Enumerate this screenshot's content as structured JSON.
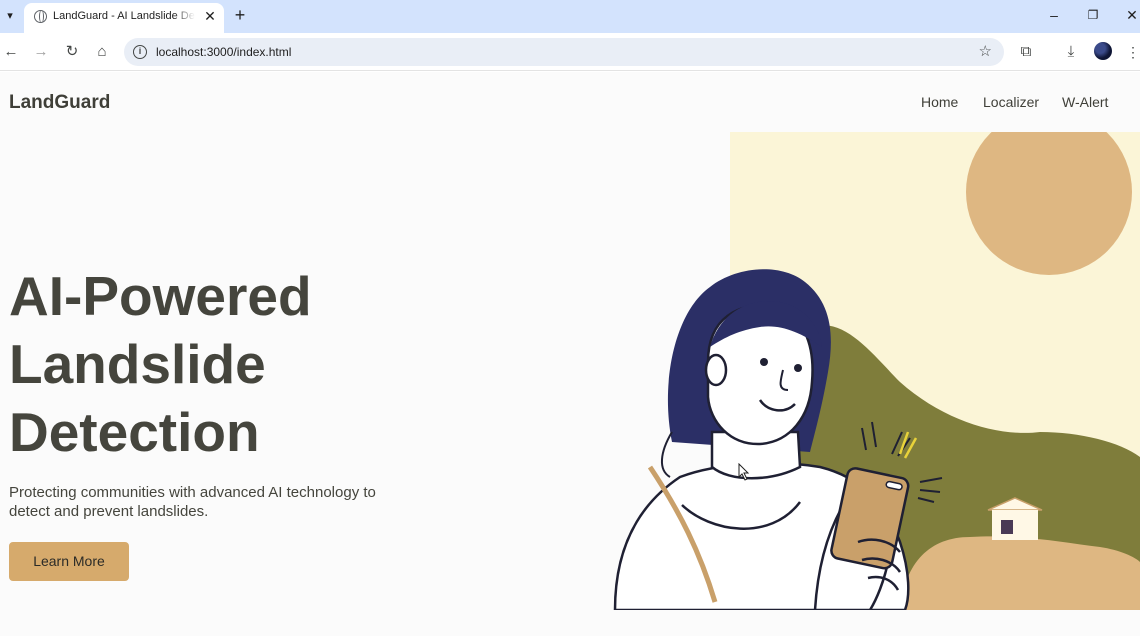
{
  "browser": {
    "tab_title": "LandGuard - AI Landslide Detection",
    "url": "localhost:3000/index.html",
    "icons": [
      "tab-search-icon",
      "globe-icon",
      "close-icon",
      "plus-icon",
      "minimize-icon",
      "restore-icon",
      "back-icon",
      "forward-icon",
      "reload-icon",
      "home-icon",
      "site-info-icon",
      "star-icon",
      "extensions-icon",
      "download-icon",
      "profile-avatar",
      "more-icon"
    ]
  },
  "site": {
    "logo": "LandGuard",
    "nav": {
      "home": "Home",
      "localizer": "Localizer",
      "walert": "W-Alert"
    },
    "hero": {
      "title_line1": "AI-Powered",
      "title_line2": "Landslide",
      "title_line3": "Detection",
      "subtitle": "Protecting communities with advanced AI technology to detect and prevent landslides.",
      "cta": "Learn More"
    },
    "colors": {
      "accent": "#d6aa6c",
      "text": "#45453d",
      "hill": "#7f7d3b",
      "sky": "#fbf5d7",
      "sun": "#deb782",
      "hair": "#2b2f66"
    }
  }
}
